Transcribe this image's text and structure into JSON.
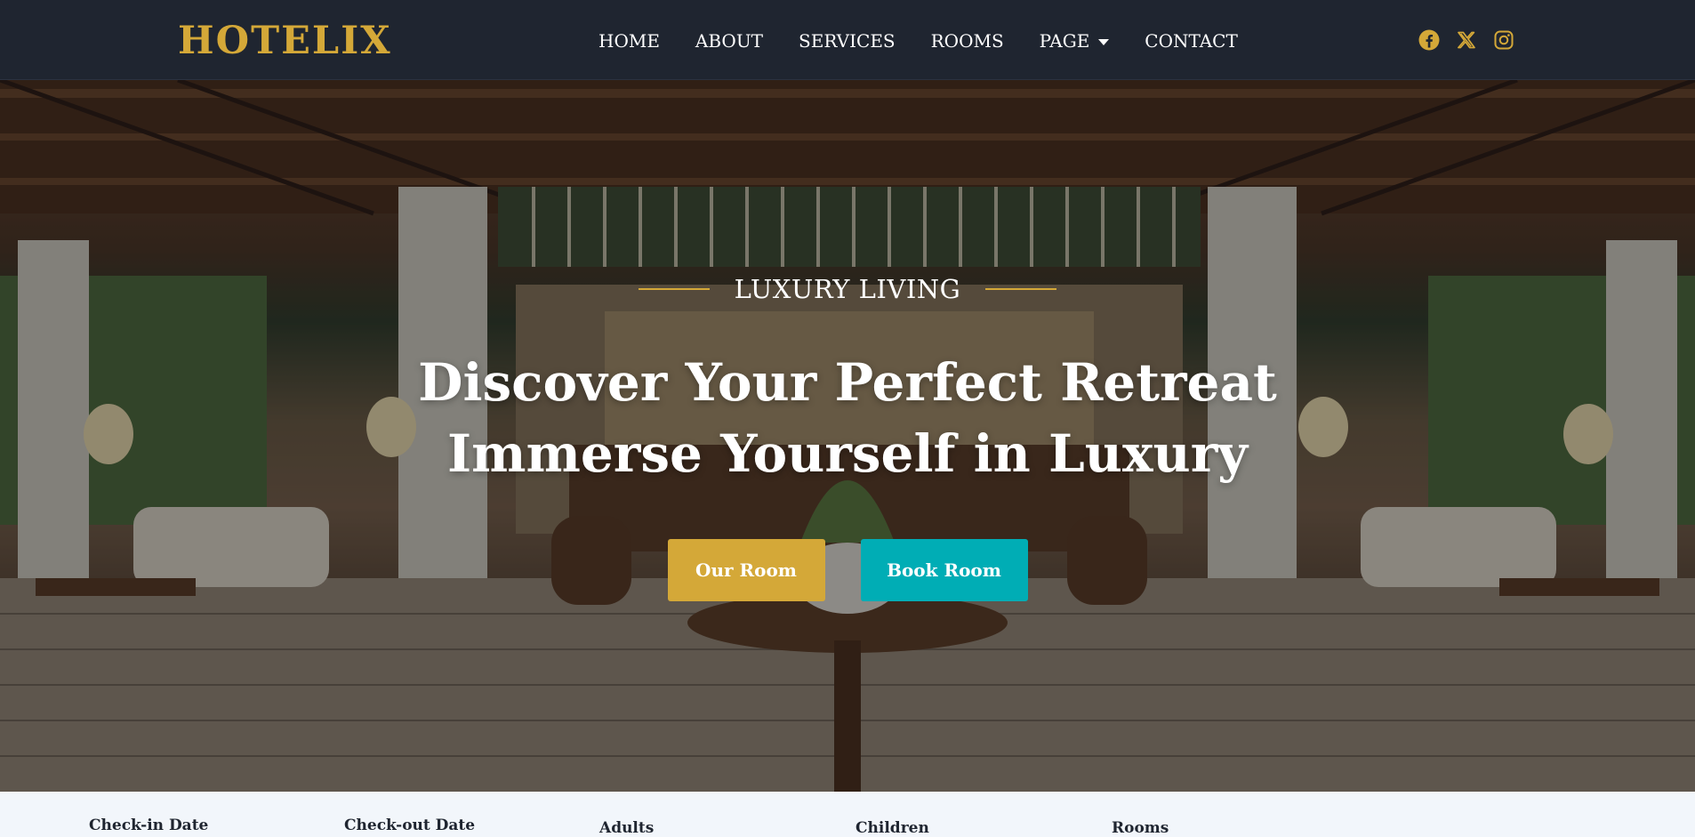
{
  "brand": {
    "logo_text": "HOTELIX",
    "accent_color": "#d4a838",
    "teal_color": "#00adb5",
    "nav_bg": "#1f2530"
  },
  "nav": {
    "items": [
      {
        "label": "HOME"
      },
      {
        "label": "ABOUT"
      },
      {
        "label": "SERVICES"
      },
      {
        "label": "ROOMS"
      },
      {
        "label": "PAGE",
        "has_dropdown": true
      },
      {
        "label": "CONTACT"
      }
    ]
  },
  "socials": [
    {
      "name": "facebook-icon"
    },
    {
      "name": "x-twitter-icon"
    },
    {
      "name": "instagram-icon"
    }
  ],
  "hero": {
    "eyebrow": "LUXURY LIVING",
    "headline_line1": "Discover Your Perfect Retreat",
    "headline_line2": "Immerse Yourself in Luxury",
    "primary_button": "Our Room",
    "secondary_button": "Book Room"
  },
  "booking": {
    "fields": [
      {
        "label": "Check-in Date"
      },
      {
        "label": "Check-out Date"
      },
      {
        "label": "Adults"
      },
      {
        "label": "Children"
      },
      {
        "label": "Rooms"
      }
    ]
  }
}
